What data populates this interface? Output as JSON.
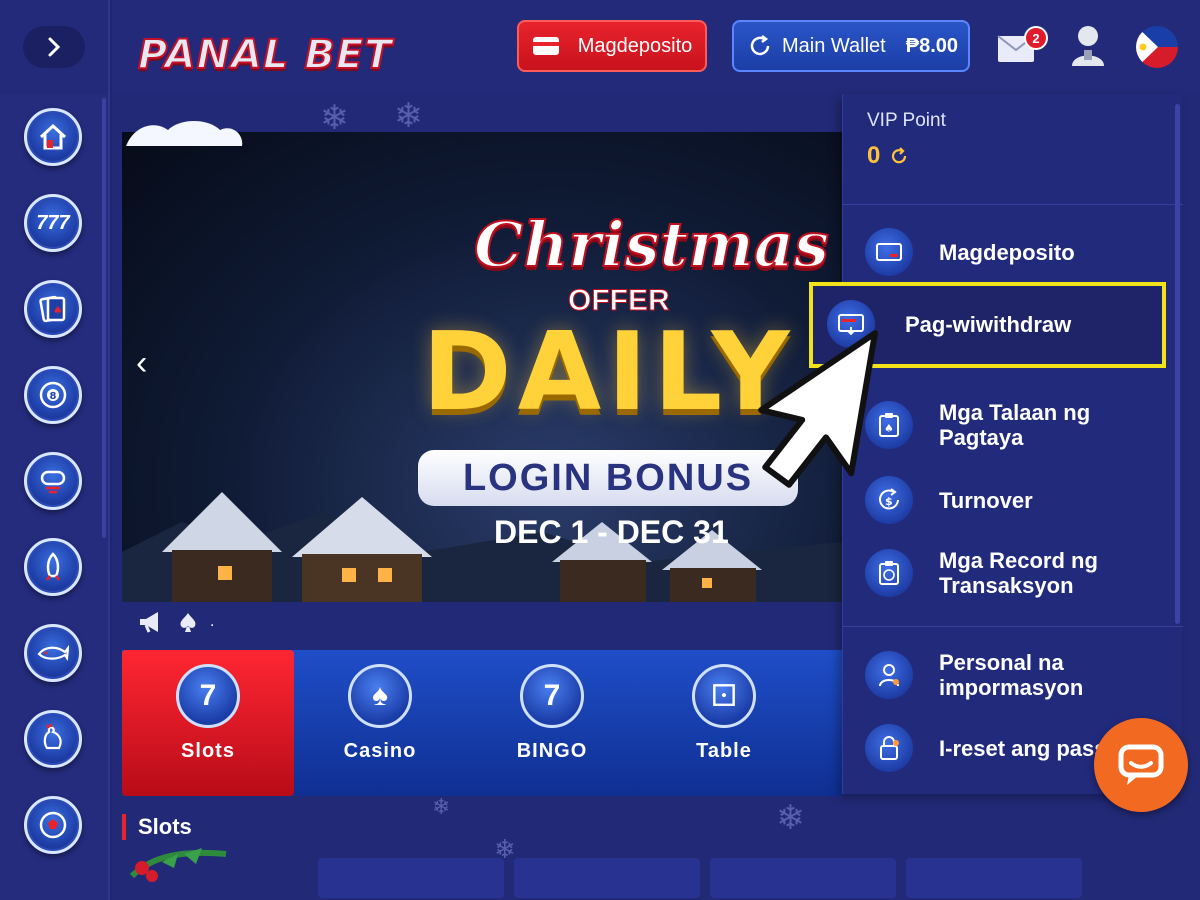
{
  "header": {
    "logo_text": "PANAL BET",
    "deposit_label": "Magdeposito",
    "wallet_label": "Main Wallet",
    "wallet_amount": "₱8.00",
    "mail_badge": "2"
  },
  "sidebar": {
    "icons": [
      "home-icon",
      "slots-777-icon",
      "cards-icon",
      "billiard-8-icon",
      "fishing-icon",
      "rocket-icon",
      "shark-icon",
      "rooster-icon",
      "soccer-ball-icon"
    ]
  },
  "banner": {
    "title": "Christmas",
    "offer": "OFFER",
    "daily": "DAILY",
    "login_bonus": "LOGIN BONUS",
    "dates": "DEC 1 - DEC 31"
  },
  "marquee": {
    "text": "."
  },
  "game_tabs": [
    {
      "label": "Slots",
      "icon_glyph": "7",
      "active": true
    },
    {
      "label": "Casino",
      "icon_glyph": "♠",
      "active": false
    },
    {
      "label": "BINGO",
      "icon_glyph": "7",
      "active": false
    },
    {
      "label": "Table",
      "icon_glyph": "⚀",
      "active": false
    }
  ],
  "section": {
    "title": "Slots"
  },
  "dropdown": {
    "vip_label": "VIP Point",
    "vip_value": "0",
    "items": [
      {
        "line1": "Magdeposito",
        "line2": ""
      },
      {
        "line1": "Pag-wiwithdraw",
        "line2": ""
      },
      {
        "line1": "Mga Talaan ng",
        "line2": "Pagtaya"
      },
      {
        "line1": "Turnover",
        "line2": ""
      },
      {
        "line1": "Mga Record ng",
        "line2": "Transaksyon"
      },
      {
        "line1": "Personal na",
        "line2": "impormasyon"
      },
      {
        "line1": "I-reset ang pass",
        "line2": ""
      }
    ]
  },
  "colors": {
    "accent_red": "#e8232e",
    "wallet_blue": "#2a55c8",
    "highlight_yellow": "#f2e21a",
    "vip_gold": "#ffc33a",
    "chat_orange": "#f26a22"
  }
}
